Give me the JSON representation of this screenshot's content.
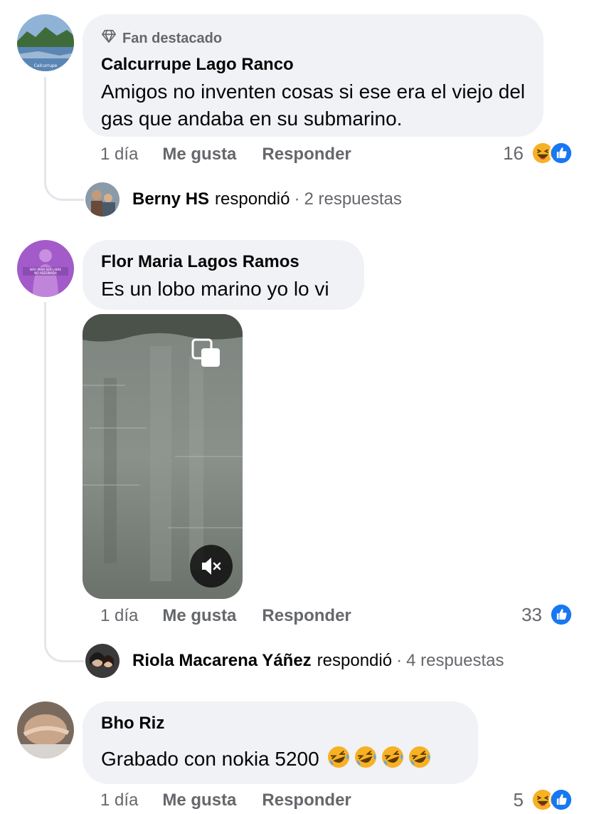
{
  "comments": [
    {
      "badge": "Fan destacado",
      "author": "Calcurrupe Lago Ranco",
      "text": "Amigos no inventen cosas si ese era el viejo del gas que andaba en su submarino.",
      "time": "1 día",
      "like_label": "Me gusta",
      "reply_label": "Responder",
      "reaction_count": "16",
      "reactions": [
        "haha-icon",
        "like-icon"
      ],
      "avatar_caption": "Calcurrupe",
      "reply_summary": {
        "name": "Berny HS",
        "verb": "respondió",
        "sep": "·",
        "count": "2 respuestas"
      }
    },
    {
      "author": "Flor Maria Lagos Ramos",
      "text": "Es un lobo marino yo lo vi",
      "time": "1 día",
      "like_label": "Me gusta",
      "reply_label": "Responder",
      "reaction_count": "33",
      "reactions": [
        "like-icon"
      ],
      "avatar_caption_1": "NÃO PARA SER LIBRE",
      "avatar_caption_2": "NO ASESINADA",
      "video": {
        "muted": true
      },
      "reply_summary": {
        "name": "Riola Macarena Yáñez",
        "verb": "respondió",
        "sep": "·",
        "count": "4 respuestas"
      }
    },
    {
      "author": "Bho Riz",
      "text": "Grabado con nokia 5200",
      "text_emojis": [
        "rofl-emoji",
        "rofl-emoji",
        "rofl-emoji",
        "rofl-emoji"
      ],
      "time": "1 día",
      "like_label": "Me gusta",
      "reply_label": "Responder",
      "reaction_count": "5",
      "reactions": [
        "haha-icon",
        "like-icon"
      ]
    }
  ],
  "colors": {
    "bubble": "#f0f2f5",
    "secondary_text": "#65676b",
    "like_blue": "#1877f2",
    "haha_yellow": "#f7b125"
  }
}
